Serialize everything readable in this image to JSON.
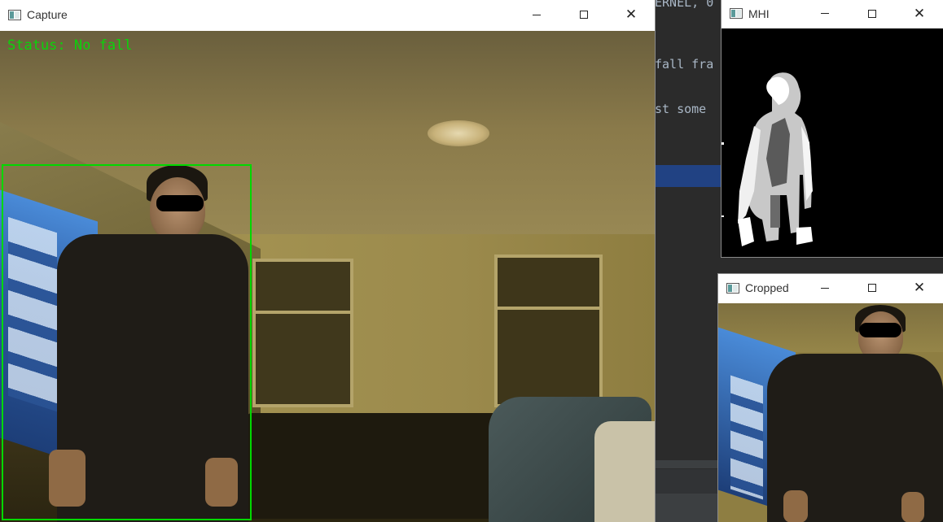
{
  "editor": {
    "lines": [
      {
        "text": "ERNEL, 0"
      },
      {
        "text": "fall fra"
      },
      {
        "text": "st some"
      }
    ]
  },
  "windows": {
    "capture": {
      "title": "Capture",
      "status_text": "Status: No fall",
      "bbox_color": "#00d800",
      "status_color": "#0ad40a"
    },
    "mhi": {
      "title": "MHI"
    },
    "cropped": {
      "title": "Cropped"
    }
  },
  "controls": {
    "minimize_icon": "minimize-icon",
    "maximize_icon": "maximize-icon",
    "close_icon": "close-icon",
    "close_glyph": "✕"
  },
  "colors": {
    "editor_bg": "#2b2b2b",
    "selection": "#214283"
  }
}
